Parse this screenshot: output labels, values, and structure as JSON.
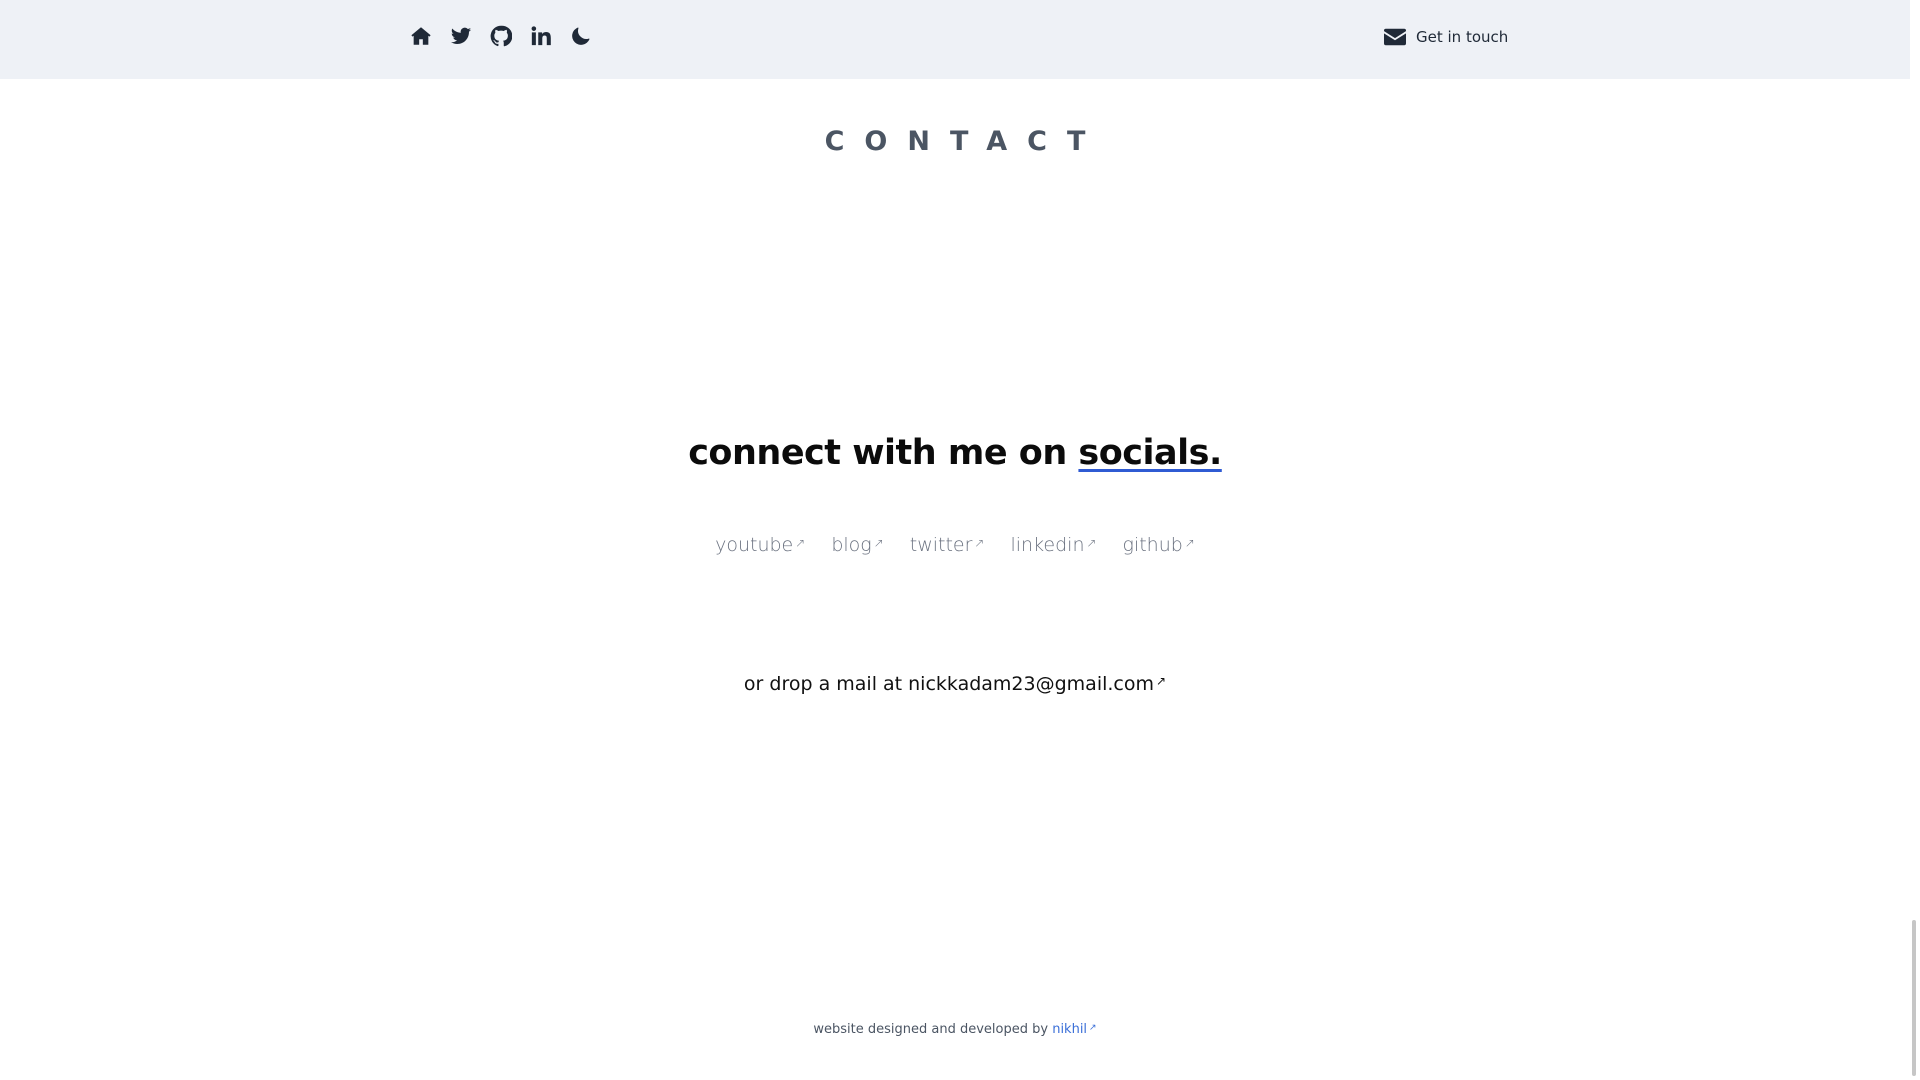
{
  "header": {
    "nav_icons": [
      "home-icon",
      "twitter-icon",
      "github-icon",
      "linkedin-icon",
      "moon-icon"
    ],
    "contact_button": {
      "icon": "mail-icon",
      "label": "Get in touch"
    },
    "background": "#eef1f6"
  },
  "main": {
    "section_title": "CONTACT",
    "headline_prefix": "connect with me on ",
    "headline_accent": "socials.",
    "accent_color": "#2f5bd3",
    "social_links": [
      {
        "label": "youtube",
        "arrow": "↗"
      },
      {
        "label": "blog",
        "arrow": "↗"
      },
      {
        "label": "twitter",
        "arrow": "↗"
      },
      {
        "label": "linkedin",
        "arrow": "↗"
      },
      {
        "label": "github",
        "arrow": "↗"
      }
    ],
    "mail_prefix": "or drop a mail at ",
    "email": "nickkadam23@gmail.com",
    "email_arrow": "↗"
  },
  "footer": {
    "text": "website designed and developed by ",
    "author": "nikhil",
    "author_arrow": "↗",
    "author_color": "#3b6fd8"
  }
}
